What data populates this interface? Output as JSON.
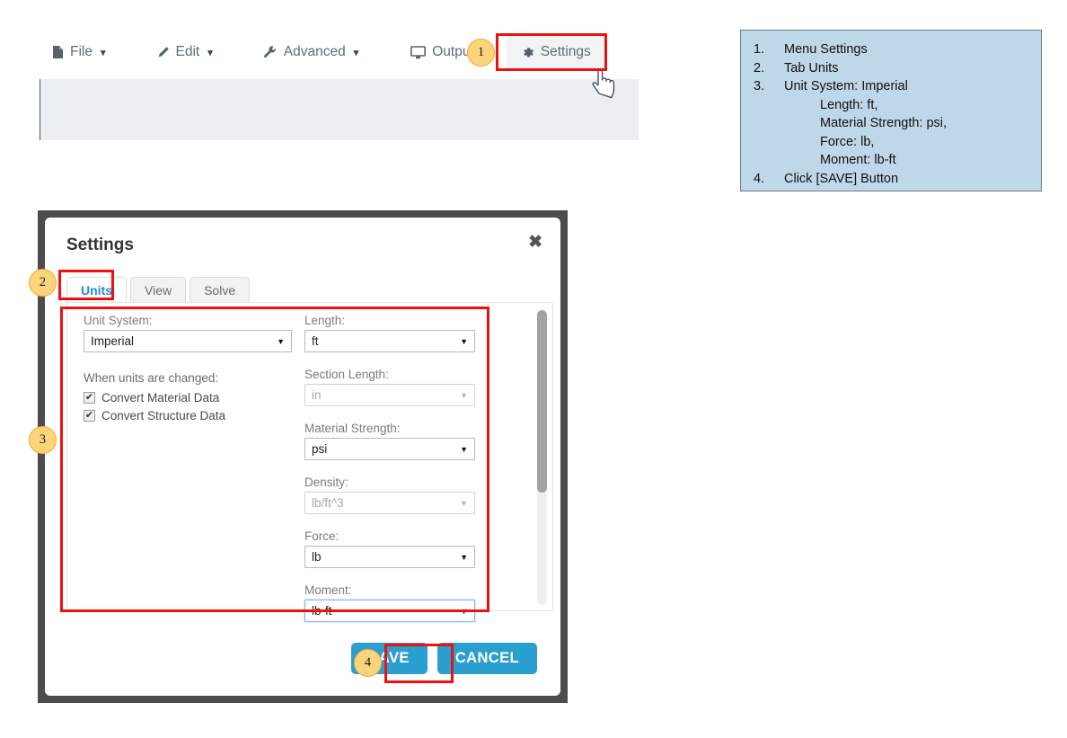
{
  "menubar": {
    "items": [
      {
        "label": "File",
        "icon": "file-icon",
        "caret": "⌄"
      },
      {
        "label": "Edit",
        "icon": "pencil-icon",
        "caret": "⌄"
      },
      {
        "label": "Advanced",
        "icon": "wrench-icon",
        "caret": "⌄"
      },
      {
        "label": "Output",
        "icon": "monitor-icon",
        "caret": ""
      },
      {
        "label": "Settings",
        "icon": "gear-icon",
        "caret": ""
      }
    ]
  },
  "cursor": {
    "icon": "pointing-hand-cursor"
  },
  "badges": {
    "one": "1",
    "two": "2",
    "three": "3",
    "four": "4"
  },
  "instructions": {
    "rows": [
      {
        "num": "1.",
        "text": "Menu Settings",
        "sub": false
      },
      {
        "num": "2.",
        "text": "Tab Units",
        "sub": false
      },
      {
        "num": "3.",
        "text": "Unit System: Imperial",
        "sub": false
      },
      {
        "num": "",
        "text": "Length: ft,",
        "sub": true
      },
      {
        "num": "",
        "text": "Material Strength: psi,",
        "sub": true
      },
      {
        "num": "",
        "text": "Force: lb,",
        "sub": true
      },
      {
        "num": "",
        "text": "Moment: lb-ft",
        "sub": true
      },
      {
        "num": "4.",
        "text": "Click [SAVE] Button",
        "sub": false
      }
    ]
  },
  "dialog": {
    "title": "Settings",
    "close_icon": "close-icon",
    "close_glyph": "✖",
    "tabs": [
      {
        "label": "Units",
        "active": true
      },
      {
        "label": "View",
        "active": false
      },
      {
        "label": "Solve",
        "active": false
      }
    ],
    "left_column": {
      "unit_system_label": "Unit System:",
      "unit_system_value": "Imperial",
      "when_changed_label": "When units are changed:",
      "checkboxes": [
        {
          "label": "Convert Material Data",
          "checked": true,
          "glyph": "✔"
        },
        {
          "label": "Convert Structure Data",
          "checked": true,
          "glyph": "✔"
        }
      ]
    },
    "right_column": {
      "fields": [
        {
          "label": "Length:",
          "value": "ft",
          "disabled": false,
          "focused": false
        },
        {
          "label": "Section Length:",
          "value": "in",
          "disabled": true,
          "focused": false
        },
        {
          "label": "Material Strength:",
          "value": "psi",
          "disabled": false,
          "focused": false
        },
        {
          "label": "Density:",
          "value": "lb/ft^3",
          "disabled": true,
          "focused": false
        },
        {
          "label": "Force:",
          "value": "lb",
          "disabled": false,
          "focused": false
        },
        {
          "label": "Moment:",
          "value": "lb-ft",
          "disabled": false,
          "focused": true
        }
      ]
    },
    "scrollbar": {
      "thumb_percent": 62
    },
    "footer": {
      "save_label": "SAVE",
      "cancel_label": "CANCEL"
    }
  },
  "colors": {
    "accent_blue": "#2b9fd0",
    "highlight_red": "#ee1111",
    "badge_fill": "#fbd47c",
    "badge_border": "#f0ad2e",
    "instruction_bg": "#bed7e9",
    "modal_frame": "#4c4c4c",
    "tab_active_text": "#1f8ddd"
  }
}
